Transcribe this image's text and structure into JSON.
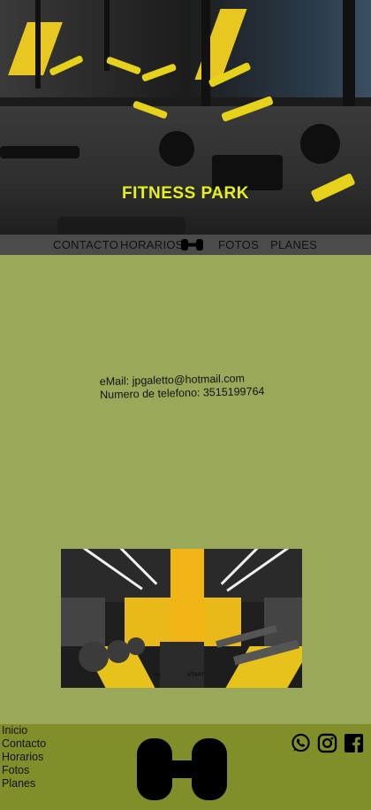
{
  "hero": {
    "title": "FITNESS PARK"
  },
  "nav": {
    "items": [
      {
        "label": "CONTACTO"
      },
      {
        "label": "HORARIOS"
      },
      {
        "label": "FOTOS"
      },
      {
        "label": "PLANES"
      }
    ],
    "logo_icon": "dumbbell-icon"
  },
  "contact": {
    "email": "eMail: jpgaletto@hotmail.com",
    "phone": "Numero de telefono: 3515199764"
  },
  "gym_image": {
    "floor_labels": [
      "01",
      "START"
    ]
  },
  "footer": {
    "links": [
      "Inicio",
      "Contacto",
      "Horarios",
      "Fotos",
      "Planes"
    ],
    "logo_icon": "dumbbell-icon",
    "social_icons": [
      "whatsapp-icon",
      "instagram-icon",
      "facebook-icon"
    ]
  },
  "colors": {
    "page_bg": "#9aa85a",
    "nav_bg": "#4b4b4c",
    "footer_bg": "#828e2a",
    "accent_yellow": "#e6f01a"
  }
}
